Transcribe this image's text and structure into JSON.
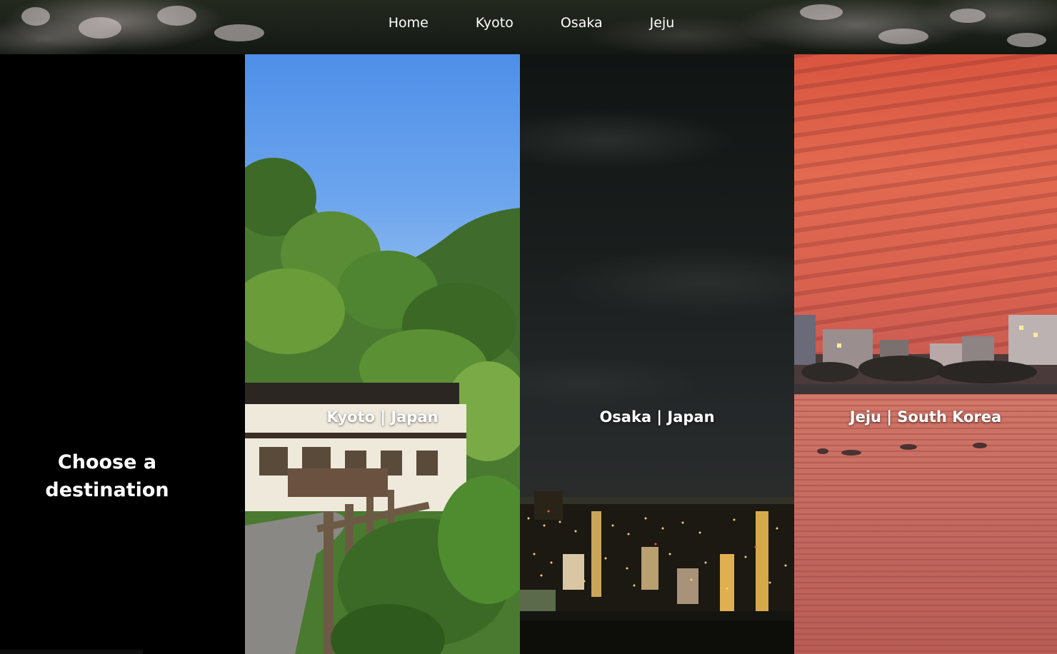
{
  "nav": {
    "links": [
      {
        "label": "Home"
      },
      {
        "label": "Kyoto"
      },
      {
        "label": "Osaka"
      },
      {
        "label": "Jeju"
      }
    ]
  },
  "intro": {
    "title": "Choose a destination"
  },
  "destinations": [
    {
      "label": "Kyoto | Japan",
      "theme": "forest-path",
      "accent": "#4e8fe8"
    },
    {
      "label": "Osaka | Japan",
      "theme": "night-city",
      "accent": "#e8b04a"
    },
    {
      "label": "Jeju | South Korea",
      "theme": "sunset-sea",
      "accent": "#e26a50"
    }
  ],
  "colors": {
    "background": "#000000",
    "text": "#ffffff",
    "nav_background": "#1a1f18"
  }
}
